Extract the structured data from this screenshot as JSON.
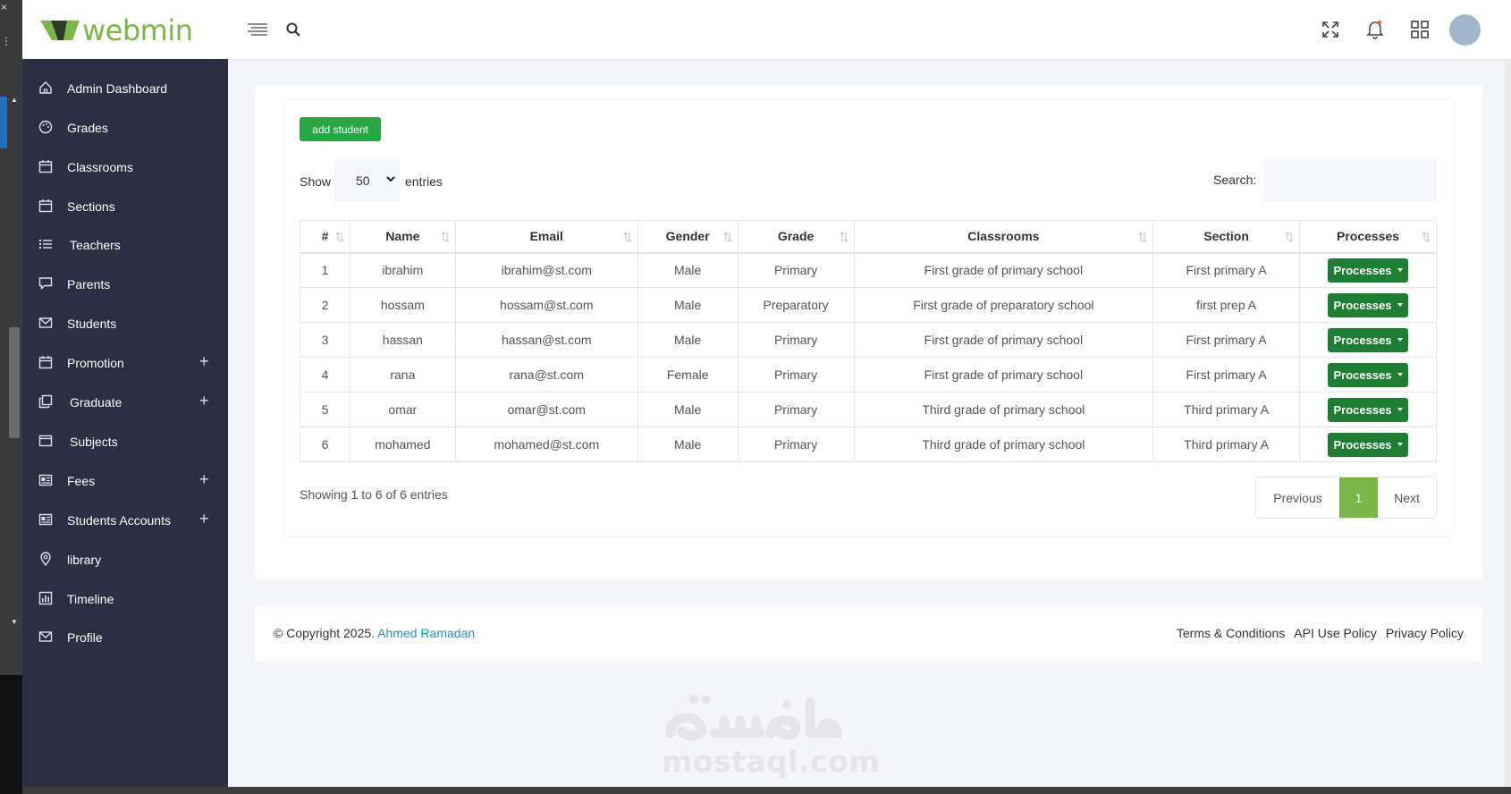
{
  "app": {
    "logo_text": "webmin",
    "brand_color": "#7ab648",
    "accent_color": "#28a745"
  },
  "header": {
    "icons": [
      "menu-lines-icon",
      "search-icon",
      "fullscreen-icon",
      "bell-icon",
      "grid-icon",
      "avatar"
    ]
  },
  "sidebar": {
    "items": [
      {
        "label": "Admin Dashboard",
        "icon": "home-icon",
        "expandable": false
      },
      {
        "label": "Grades",
        "icon": "palette-icon",
        "expandable": false
      },
      {
        "label": "Classrooms",
        "icon": "calendar-icon",
        "expandable": false
      },
      {
        "label": "Sections",
        "icon": "calendar-icon",
        "expandable": false
      },
      {
        "label": "Teachers",
        "icon": "list-icon",
        "expandable": false
      },
      {
        "label": "Parents",
        "icon": "chat-icon",
        "expandable": false
      },
      {
        "label": "Students",
        "icon": "envelope-icon",
        "expandable": false
      },
      {
        "label": "Promotion",
        "icon": "calendar-icon",
        "expandable": true
      },
      {
        "label": "Graduate",
        "icon": "copy-icon",
        "expandable": true
      },
      {
        "label": "Subjects",
        "icon": "window-icon",
        "expandable": false
      },
      {
        "label": "Fees",
        "icon": "id-card-icon",
        "expandable": true
      },
      {
        "label": "Students Accounts",
        "icon": "id-card-icon",
        "expandable": true
      },
      {
        "label": "library",
        "icon": "map-pin-icon",
        "expandable": false
      },
      {
        "label": "Timeline",
        "icon": "chart-icon",
        "expandable": false
      },
      {
        "label": "Profile",
        "icon": "envelope-icon",
        "expandable": false
      }
    ],
    "expand_symbol": "+"
  },
  "toolbar": {
    "add_label": "add student",
    "show_label": "Show",
    "entries_value": "50",
    "entries_label": "entries",
    "search_label": "Search:",
    "search_placeholder": ""
  },
  "table": {
    "columns": [
      "#",
      "Name",
      "Email",
      "Gender",
      "Grade",
      "Classrooms",
      "Section",
      "Processes"
    ],
    "rows": [
      [
        "1",
        "ibrahim",
        "ibrahim@st.com",
        "Male",
        "Primary",
        "First grade of primary school",
        "First primary A",
        "Processes"
      ],
      [
        "2",
        "hossam",
        "hossam@st.com",
        "Male",
        "Preparatory",
        "First grade of preparatory school",
        "first prep A",
        "Processes"
      ],
      [
        "3",
        "hassan",
        "hassan@st.com",
        "Male",
        "Primary",
        "First grade of primary school",
        "First primary A",
        "Processes"
      ],
      [
        "4",
        "rana",
        "rana@st.com",
        "Female",
        "Primary",
        "First grade of primary school",
        "First primary A",
        "Processes"
      ],
      [
        "5",
        "omar",
        "omar@st.com",
        "Male",
        "Primary",
        "Third grade of primary school",
        "Third primary A",
        "Processes"
      ],
      [
        "6",
        "mohamed",
        "mohamed@st.com",
        "Male",
        "Primary",
        "Third grade of primary school",
        "Third primary A",
        "Processes"
      ]
    ]
  },
  "pagination": {
    "info": "Showing 1 to 6 of 6 entries",
    "previous": "Previous",
    "current": "1",
    "next": "Next"
  },
  "footer": {
    "copyright": "© Copyright 2025.",
    "author": "Ahmed Ramadan",
    "links": [
      "Terms & Conditions",
      "API Use Policy",
      "Privacy Policy"
    ]
  },
  "watermark": {
    "latin": "mostaql.com"
  }
}
